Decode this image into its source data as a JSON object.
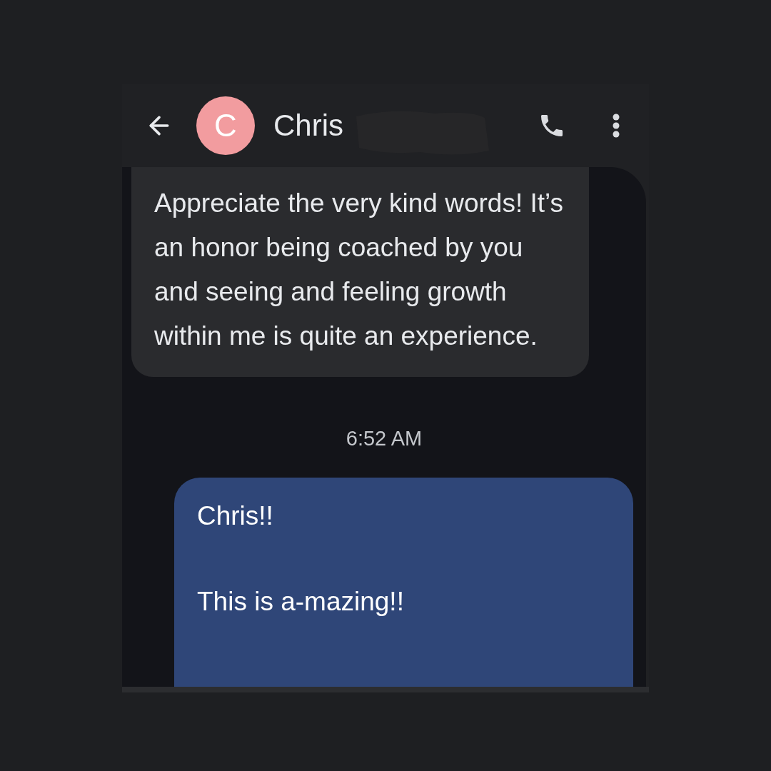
{
  "header": {
    "avatar_letter": "C",
    "contact_name": "Chris",
    "name_redacted": true
  },
  "messages": [
    {
      "kind": "incoming",
      "text": "Appreciate the very kind words! It’s an honor being coached by you and seeing and feeling growth within me is quite an experience."
    },
    {
      "kind": "timestamp",
      "text": "6:52 AM"
    },
    {
      "kind": "outgoing",
      "text": "Chris!!\n\nThis is a-mazing!!"
    }
  ]
}
